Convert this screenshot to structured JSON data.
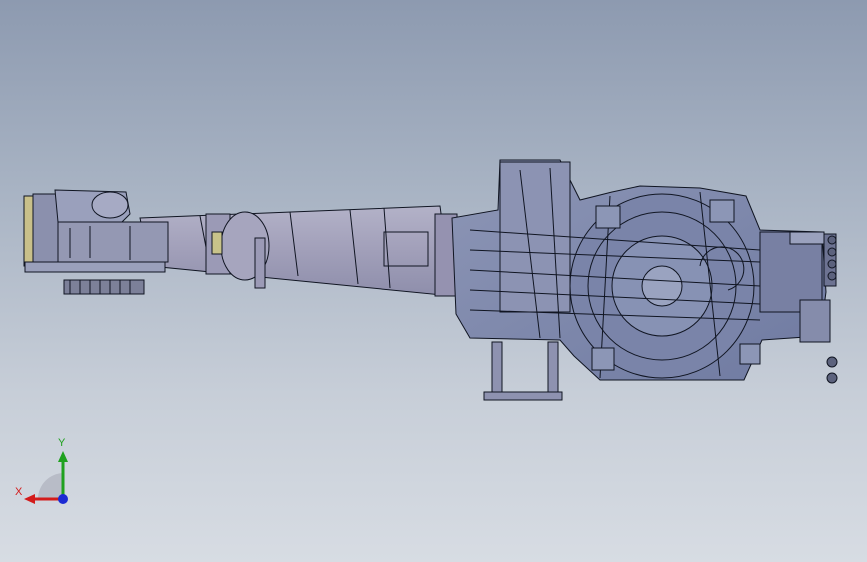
{
  "viewport": {
    "model": "robot-arm-wireframe",
    "background_top": "#8d9ab0",
    "background_bottom": "#d7dce3",
    "line_color": "#101522",
    "part_fill": "#7f8aac",
    "arm_fill": "#a3a4bd"
  },
  "triad": {
    "x_label": "X",
    "y_label": "Y",
    "x_color": "#d31b1b",
    "y_color": "#1fa11f",
    "z_color": "#1b2ad3"
  }
}
